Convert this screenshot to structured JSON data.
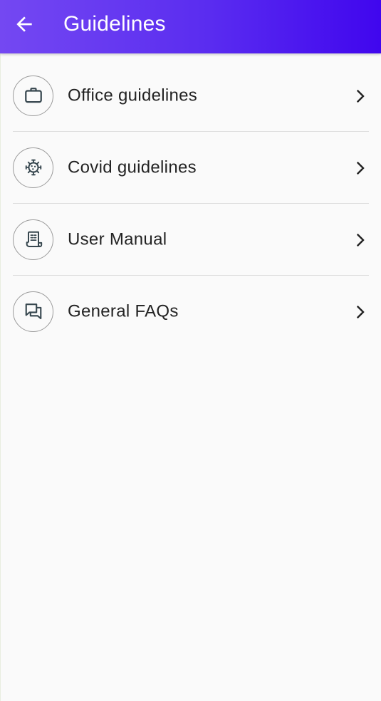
{
  "header": {
    "title": "Guidelines",
    "background_gradient": [
      "#7448f2",
      "#4006ee"
    ],
    "back_icon": "arrow-left-icon"
  },
  "list": {
    "items": [
      {
        "label": "Office guidelines",
        "icon": "briefcase-icon"
      },
      {
        "label": "Covid guidelines",
        "icon": "virus-icon"
      },
      {
        "label": "User Manual",
        "icon": "receipt-document-icon"
      },
      {
        "label": "General FAQs",
        "icon": "chat-bubbles-icon"
      }
    ],
    "chevron_icon": "chevron-right-icon",
    "icon_color": "#37474f"
  }
}
